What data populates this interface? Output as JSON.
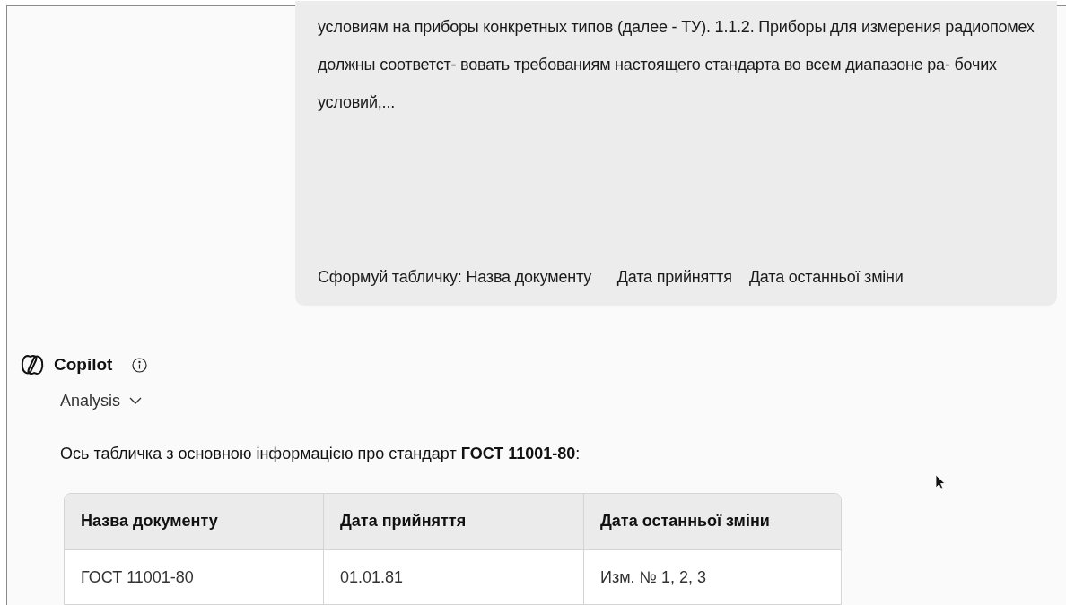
{
  "user_message": {
    "text": "условиям на приборы конкретных типов (далее - ТУ). 1.1.2. Приборы для измерения радиопомех должны соответст- вовать требованиям настоящего стандарта во всем диапазоне ра- бочих условий,...",
    "prompt": "Сформуй табличку: Назва документу      Дата прийняття    Дата останньої зміни"
  },
  "assistant": {
    "name": "Copilot",
    "mode": "Analysis",
    "expanded": false,
    "intro": "Ось табличка з основною інформацією про стандарт **ГОСТ 11001-80**:",
    "table": {
      "columns": [
        "Назва документу",
        "Дата прийняття",
        "Дата останньої зміни"
      ],
      "rows": [
        [
          "ГОСТ 11001-80",
          "01.01.81",
          "Изм. № 1, 2, 3"
        ]
      ]
    }
  }
}
